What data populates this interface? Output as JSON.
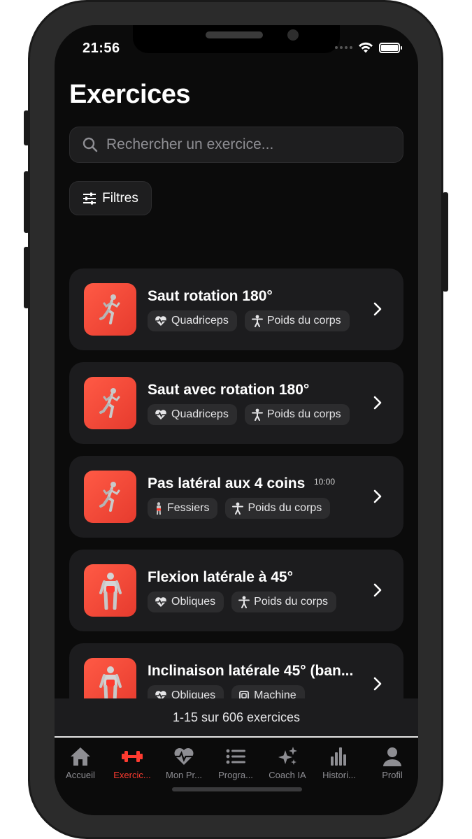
{
  "status_bar": {
    "time": "21:56"
  },
  "header": {
    "title": "Exercices"
  },
  "search": {
    "placeholder": "Rechercher un exercice..."
  },
  "filters": {
    "label": "Filtres"
  },
  "exercises": [
    {
      "title": "Saut rotation 180°",
      "time": "",
      "tags": [
        {
          "icon": "heart-pulse-icon",
          "label": "Quadriceps"
        },
        {
          "icon": "person-icon",
          "label": "Poids du corps"
        }
      ],
      "thumb": "runner-figure"
    },
    {
      "title": "Saut avec rotation 180°",
      "time": "",
      "tags": [
        {
          "icon": "heart-pulse-icon",
          "label": "Quadriceps"
        },
        {
          "icon": "person-icon",
          "label": "Poids du corps"
        }
      ],
      "thumb": "runner-figure"
    },
    {
      "title": "Pas latéral aux 4 coins",
      "time": "10:00",
      "tags": [
        {
          "icon": "body-glutes-icon",
          "label": "Fessiers"
        },
        {
          "icon": "person-icon",
          "label": "Poids du corps"
        }
      ],
      "thumb": "runner-figure"
    },
    {
      "title": "Flexion latérale à 45°",
      "time": "",
      "tags": [
        {
          "icon": "heart-pulse-icon",
          "label": "Obliques"
        },
        {
          "icon": "person-icon",
          "label": "Poids du corps"
        }
      ],
      "thumb": "torso-figure"
    },
    {
      "title": "Inclinaison latérale 45° (ban...",
      "time": "",
      "tags": [
        {
          "icon": "heart-pulse-icon",
          "label": "Obliques"
        },
        {
          "icon": "machine-icon",
          "label": "Machine"
        }
      ],
      "thumb": "torso-figure"
    }
  ],
  "pagination": {
    "text": "1-15 sur 606 exercices"
  },
  "tabbar": {
    "active_color": "#ff3b30",
    "inactive_color": "#8e8e93",
    "items": [
      {
        "label": "Accueil",
        "icon": "home-icon"
      },
      {
        "label": "Exercic...",
        "icon": "dumbbell-icon"
      },
      {
        "label": "Mon Pr...",
        "icon": "heart-pulse-icon"
      },
      {
        "label": "Progra...",
        "icon": "list-icon"
      },
      {
        "label": "Coach IA",
        "icon": "sparkles-icon"
      },
      {
        "label": "Histori...",
        "icon": "bar-chart-icon"
      },
      {
        "label": "Profil",
        "icon": "person-icon"
      }
    ]
  },
  "colors": {
    "accent": "#ff3b30",
    "card": "#1c1c1e",
    "background": "#0b0b0b"
  }
}
